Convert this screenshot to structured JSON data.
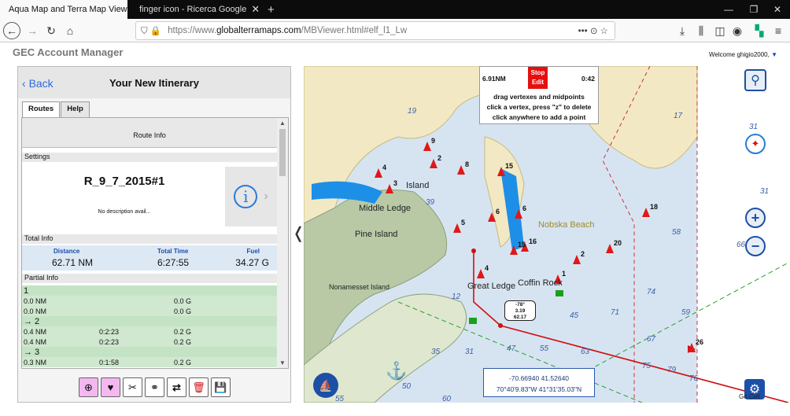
{
  "browser": {
    "tabs": [
      {
        "title": "Aqua Map and Terra Map Viewe",
        "close": "✕"
      },
      {
        "title": "finger icon - Ricerca Google",
        "close": "✕"
      }
    ],
    "new_tab": "+",
    "url_scheme": "https://www.",
    "url_host": "globalterramaps.com",
    "url_path": "/MBViewer.html#elf_l1_Lw",
    "url_actions": "••• ⊙ ☆"
  },
  "page": {
    "header": "GEC Account Manager",
    "welcome": "Welcome ghigio2000,"
  },
  "panel": {
    "back": "Back",
    "title": "Your New Itinerary",
    "tabs": [
      "Routes",
      "Help"
    ],
    "route_info": "Route Info",
    "settings_label": "Settings",
    "route_name": "R_9_7_2015#1",
    "description": "No description avail...",
    "total_info_label": "Total Info",
    "totals": {
      "distance_label": "Distance",
      "distance": "62.71 NM",
      "time_label": "Total Time",
      "time": "6:27:55",
      "fuel_label": "Fuel",
      "fuel": "34.27 G"
    },
    "partial_info_label": "Partial Info",
    "partials": [
      {
        "head": "1",
        "rows": [
          [
            "0.0 NM",
            "",
            "0.0 G"
          ],
          [
            "0.0 NM",
            "",
            "0.0 G"
          ]
        ]
      },
      {
        "head": "→ 2",
        "rows": [
          [
            "0.4 NM",
            "0:2:23",
            "0.2 G"
          ],
          [
            "0.4 NM",
            "0:2:23",
            "0.2 G"
          ]
        ]
      },
      {
        "head": "→ 3",
        "rows": [
          [
            "0.3 NM",
            "0:1:58",
            "0.2 G"
          ]
        ]
      }
    ]
  },
  "map": {
    "edit": {
      "distance": "6.91NM",
      "stop": "Stop Edit",
      "time": "0:42",
      "lines": [
        "drag vertexes and midpoints",
        "click a vertex, press \"z\" to delete",
        "click anywhere to add a point"
      ]
    },
    "callout": [
      "-78°",
      "3.19",
      "62.17"
    ],
    "coords": [
      "-70.66940 41.52640",
      "70°40'9.83\"W 41°31'35.03\"N"
    ],
    "labels": {
      "island": "Island",
      "middle_ledge": "Middle Ledge",
      "pine_island": "Pine Island",
      "nonamesset": "Nonamesset Island",
      "great_ledge": "Great Ledge",
      "coffin_rock": "Coffin Rock",
      "nobska": "Nobska Beach",
      "go_cell": "Go Cell"
    },
    "markers": [
      "9",
      "8",
      "2",
      "3",
      "4",
      "15",
      "5",
      "6",
      "6",
      "16",
      "15",
      "4",
      "2",
      "1",
      "18",
      "20",
      "26"
    ],
    "depths": [
      "19",
      "39",
      "31",
      "17",
      "31",
      "12",
      "35",
      "31",
      "47",
      "55",
      "63",
      "45",
      "71",
      "67",
      "75",
      "79",
      "74",
      "59",
      "76",
      "50",
      "60",
      "55",
      "66",
      "58",
      "31"
    ]
  }
}
